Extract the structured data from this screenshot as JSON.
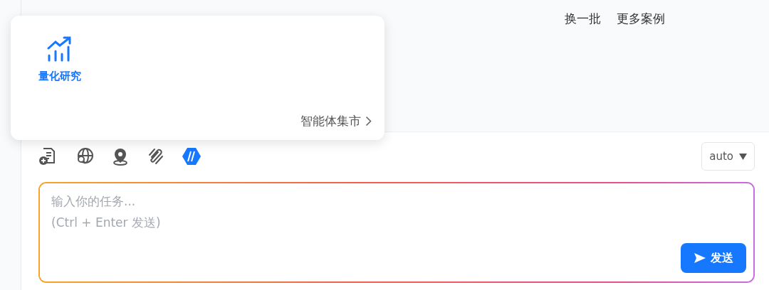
{
  "top_links": [
    "换一批",
    "更多案例"
  ],
  "agent_popover": {
    "items": [
      {
        "label": "量化研究",
        "kind": "chart",
        "selected": true
      }
    ],
    "footer_link": "智能体集市"
  },
  "tools": [
    {
      "kind": "document-add",
      "selected": false
    },
    {
      "kind": "web-search",
      "selected": false
    },
    {
      "kind": "location",
      "selected": false
    },
    {
      "kind": "attachment",
      "selected": false
    },
    {
      "kind": "code-mode",
      "selected": true
    }
  ],
  "model_select": {
    "value": "auto"
  },
  "task_input": {
    "placeholder": "输入你的任务...\n(Ctrl + Enter 发送)"
  },
  "send_button": {
    "label": "发送"
  }
}
